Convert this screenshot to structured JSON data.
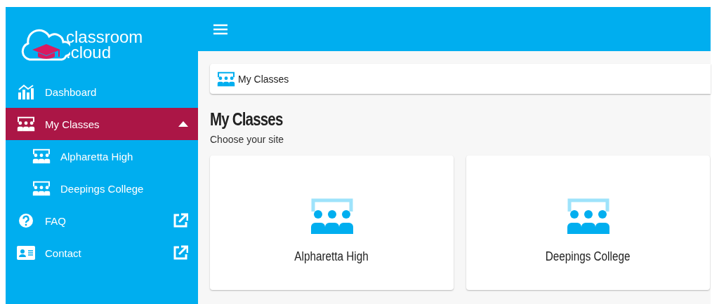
{
  "logo": {
    "line_1": "classroom",
    "line_2": ".cloud"
  },
  "sidebar": {
    "items": [
      {
        "label": "Dashboard",
        "kind": "chart",
        "selected": false,
        "external": false
      },
      {
        "label": "My Classes",
        "kind": "classes",
        "selected": true,
        "external": false,
        "expanded": true,
        "children": [
          {
            "label": "Alpharetta High",
            "kind": "classes",
            "selected": false,
            "external": false
          },
          {
            "label": "Deepings College",
            "kind": "classes",
            "selected": false,
            "external": false
          }
        ]
      },
      {
        "label": "FAQ",
        "kind": "help",
        "selected": false,
        "external": true
      },
      {
        "label": "Contact",
        "kind": "contact",
        "selected": false,
        "external": true
      }
    ]
  },
  "breadcrumb": {
    "label": "My Classes"
  },
  "page": {
    "title": "My Classes",
    "subtitle": "Choose your site"
  },
  "cards": [
    {
      "label": "Alpharetta High"
    },
    {
      "label": "Deepings College"
    }
  ]
}
